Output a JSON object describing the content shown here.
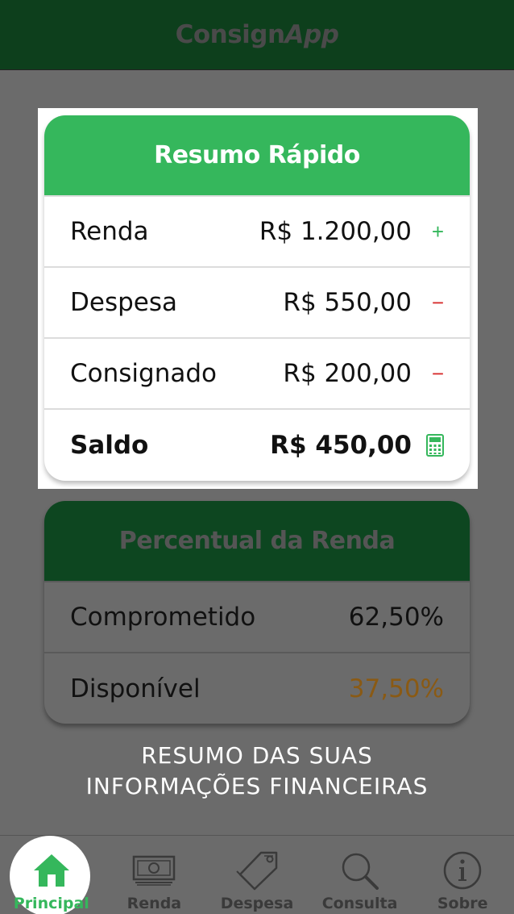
{
  "header": {
    "title_main": "Consign",
    "title_italic": "App"
  },
  "quick_summary": {
    "title": "Resumo Rápido",
    "rows": [
      {
        "label": "Renda",
        "value": "R$ 1.200,00",
        "sign": "+"
      },
      {
        "label": "Despesa",
        "value": "R$ 550,00",
        "sign": "−"
      },
      {
        "label": "Consignado",
        "value": "R$ 200,00",
        "sign": "−"
      },
      {
        "label": "Saldo",
        "value": "R$ 450,00",
        "icon": "calculator-icon"
      }
    ]
  },
  "income_percent": {
    "title": "Percentual da Renda",
    "rows": [
      {
        "label": "Comprometido",
        "value": "62,50%"
      },
      {
        "label": "Disponível",
        "value": "37,50%"
      }
    ]
  },
  "caption": {
    "line1": "RESUMO DAS SUAS",
    "line2": "INFORMAÇÕES FINANCEIRAS"
  },
  "tabs": [
    {
      "label": "Principal",
      "icon": "home-icon",
      "active": true
    },
    {
      "label": "Renda",
      "icon": "banknote-icon"
    },
    {
      "label": "Despesa",
      "icon": "price-tag-icon"
    },
    {
      "label": "Consulta",
      "icon": "search-icon"
    },
    {
      "label": "Sobre",
      "icon": "info-icon"
    }
  ],
  "colors": {
    "header_bg": "#0d3f1c",
    "accent_green": "#35b75c",
    "overlay": "#6b6b6b",
    "minus_red": "#d62b2b",
    "warn_amber": "#8a5a14"
  }
}
